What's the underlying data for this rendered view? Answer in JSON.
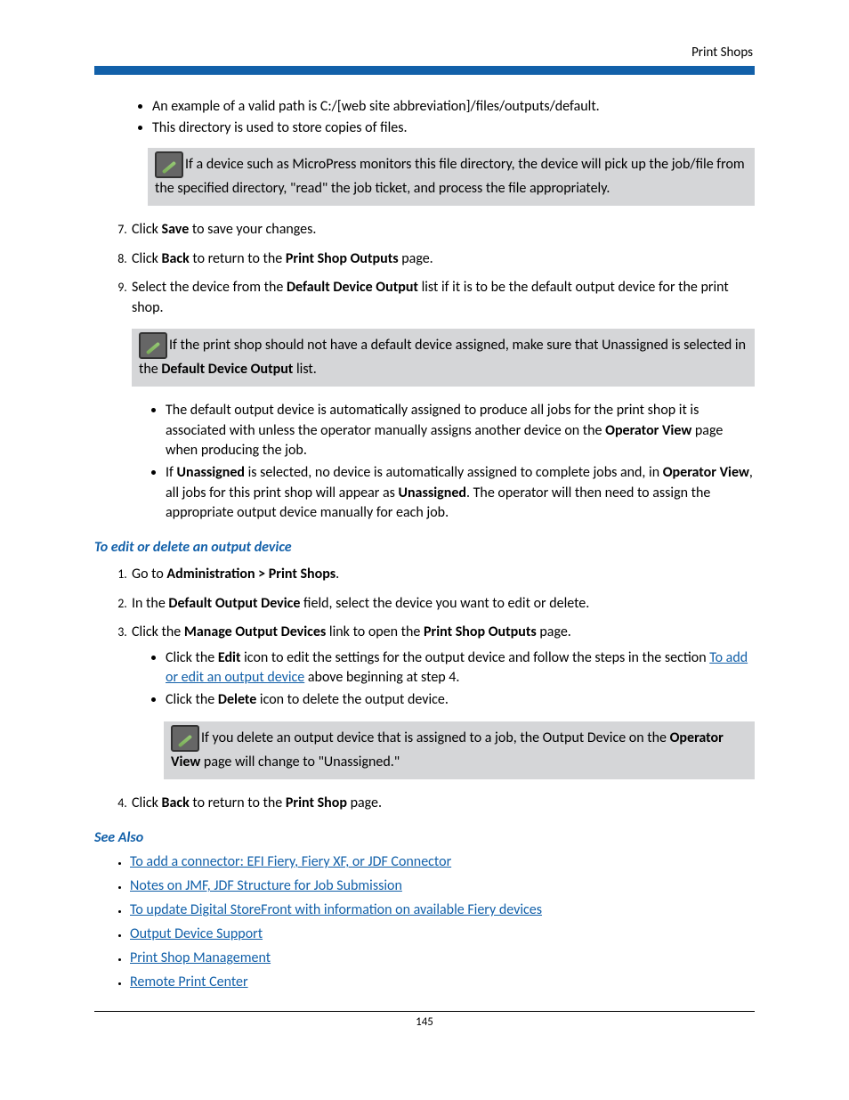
{
  "header": {
    "section": "Print Shops"
  },
  "intro_bullets": [
    "An example of a valid path is C:/[web site abbreviation]/files/outputs/default.",
    "This directory is used to store copies of files."
  ],
  "note1": "If a device such as MicroPress monitors this file directory, the device will pick up the job/file from the specified directory, \"read\" the job ticket, and process the file appropriately.",
  "steps_a": {
    "s7": {
      "pre": "Click ",
      "b": "Save",
      "post": " to save your changes."
    },
    "s8": {
      "pre": "Click ",
      "b": "Back",
      "mid": " to return to the ",
      "b2": "Print Shop Outputs",
      "post": " page."
    },
    "s9": {
      "pre": "Select the device from the ",
      "b": "Default Device Output",
      "post": " list if it is to be the default output device for the print shop."
    }
  },
  "note2": {
    "pre": "If the print shop should not have a default device assigned, make sure that Unassigned is selected in the ",
    "b": "Default Device Output",
    "post": " list."
  },
  "bullets_b": {
    "i1": {
      "pre": "The default output device is automatically assigned to produce all jobs for the print shop it is associated with unless the operator manually assigns another device on the ",
      "b": "Operator View",
      "post": " page when producing the job."
    },
    "i2": {
      "pre": "If ",
      "b1": "Unassigned",
      "mid1": " is selected, no device is automatically assigned to complete jobs and, in ",
      "b2": "Operator View",
      "mid2": ", all jobs for this print shop will appear as ",
      "b3": "Unassigned",
      "post": ". The operator will then need to assign the appropriate output device manually for each job."
    }
  },
  "heading_edit": "To edit or delete an output device",
  "steps_c": {
    "s1": {
      "pre": "Go to ",
      "b": "Administration > Print Shops",
      "post": "."
    },
    "s2": {
      "pre": "In the ",
      "b": "Default Output Device",
      "post": " field, select the device you want to edit or delete."
    },
    "s3": {
      "pre": "Click the ",
      "b": "Manage Output Devices",
      "mid": " link to open the ",
      "b2": "Print Shop Outputs",
      "post": " page."
    },
    "s3sub": {
      "a": {
        "pre": "Click the ",
        "b": "Edit",
        "mid": " icon to edit the settings for the output device and follow the steps in the section ",
        "link": "To add or edit an output device",
        "post": " above beginning at step 4."
      },
      "b": {
        "pre": "Click the ",
        "b": "Delete",
        "post": " icon to delete the output device."
      }
    },
    "note3": {
      "pre": "If you delete an output device that is assigned to a job, the Output Device on the ",
      "b": "Operator View",
      "post": " page will change to \"Unassigned.\""
    },
    "s4": {
      "pre": "Click ",
      "b": "Back",
      "mid": " to return to the ",
      "b2": "Print Shop",
      "post": " page."
    }
  },
  "see_also_heading": "See Also",
  "see_also": [
    "To add a connector: EFI Fiery,  Fiery XF, or JDF Connector",
    "Notes on JMF, JDF Structure for Job Submission",
    "To update Digital StoreFront with information on available Fiery devices",
    "Output Device Support",
    "Print Shop Management",
    "Remote Print Center"
  ],
  "footer": {
    "page": "145"
  }
}
